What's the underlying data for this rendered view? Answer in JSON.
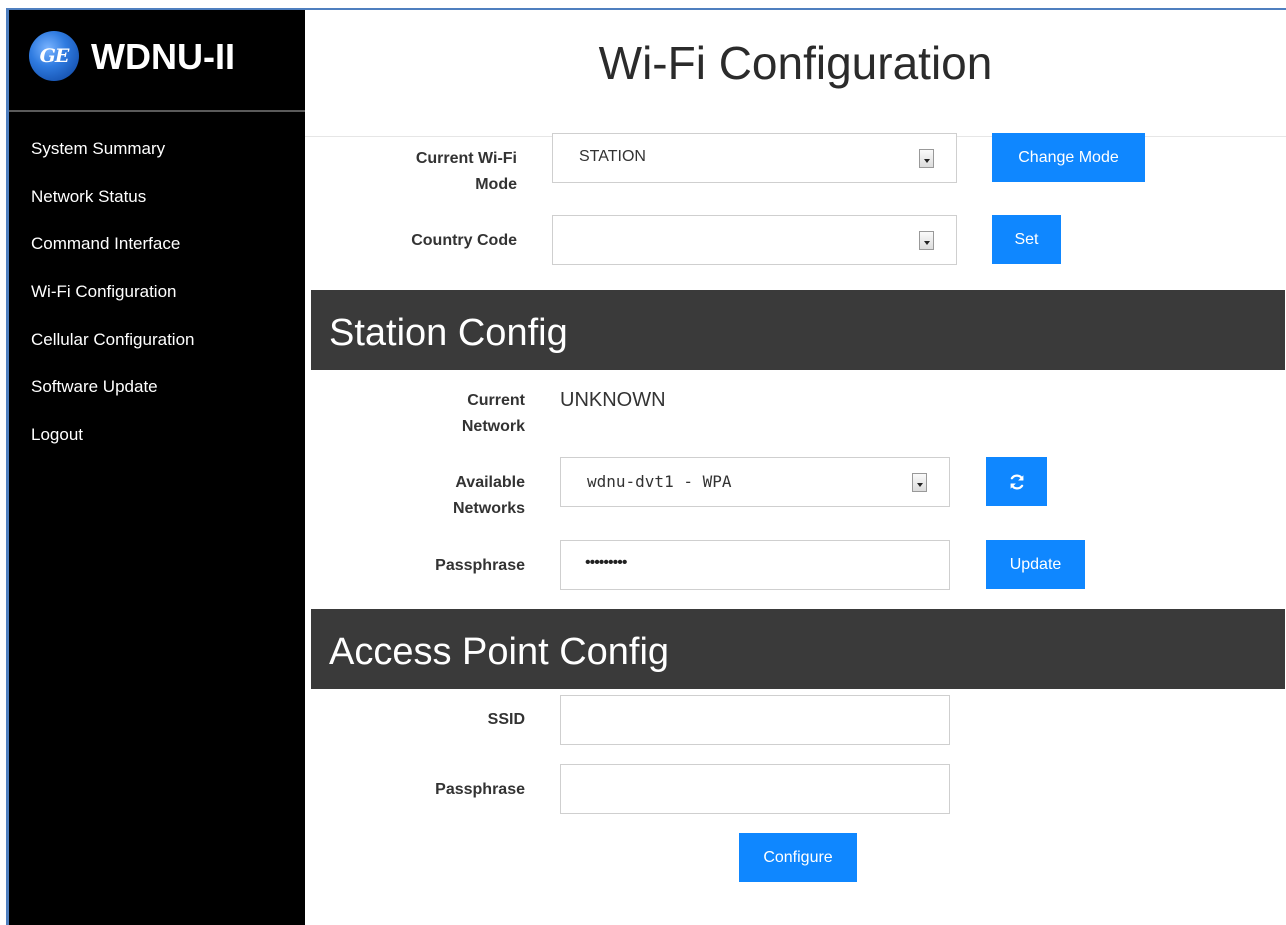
{
  "brand": {
    "title": "WDNU-II",
    "logo_text": "GE",
    "logo_icon": "ge-logo-icon"
  },
  "nav": {
    "items": [
      {
        "label": "System Summary"
      },
      {
        "label": "Network Status"
      },
      {
        "label": "Command Interface"
      },
      {
        "label": "Wi-Fi Configuration"
      },
      {
        "label": "Cellular Configuration"
      },
      {
        "label": "Software Update"
      },
      {
        "label": "Logout"
      }
    ]
  },
  "page": {
    "title": "Wi-Fi Configuration"
  },
  "mode": {
    "label_line1": "Current Wi-Fi",
    "label_line2": "Mode",
    "selected": "STATION",
    "button": "Change Mode"
  },
  "country": {
    "label": "Country Code",
    "selected": "",
    "button": "Set"
  },
  "station": {
    "heading": "Station Config",
    "current_label_line1": "Current",
    "current_label_line2": "Network",
    "current_value": "UNKNOWN",
    "networks_label_line1": "Available",
    "networks_label_line2": "Networks",
    "networks_selected": "wdnu-dvt1 - WPA",
    "refresh_icon": "refresh-icon",
    "passphrase_label": "Passphrase",
    "passphrase_value": "•••••••••",
    "update_button": "Update"
  },
  "ap": {
    "heading": "Access Point Config",
    "ssid_label": "SSID",
    "ssid_value": "",
    "passphrase_label": "Passphrase",
    "passphrase_value": "",
    "configure_button": "Configure"
  },
  "colors": {
    "accent": "#0f87ff",
    "sidebar": "#000000",
    "section_band": "#3a3a3a",
    "frame": "#4f7fbf"
  }
}
